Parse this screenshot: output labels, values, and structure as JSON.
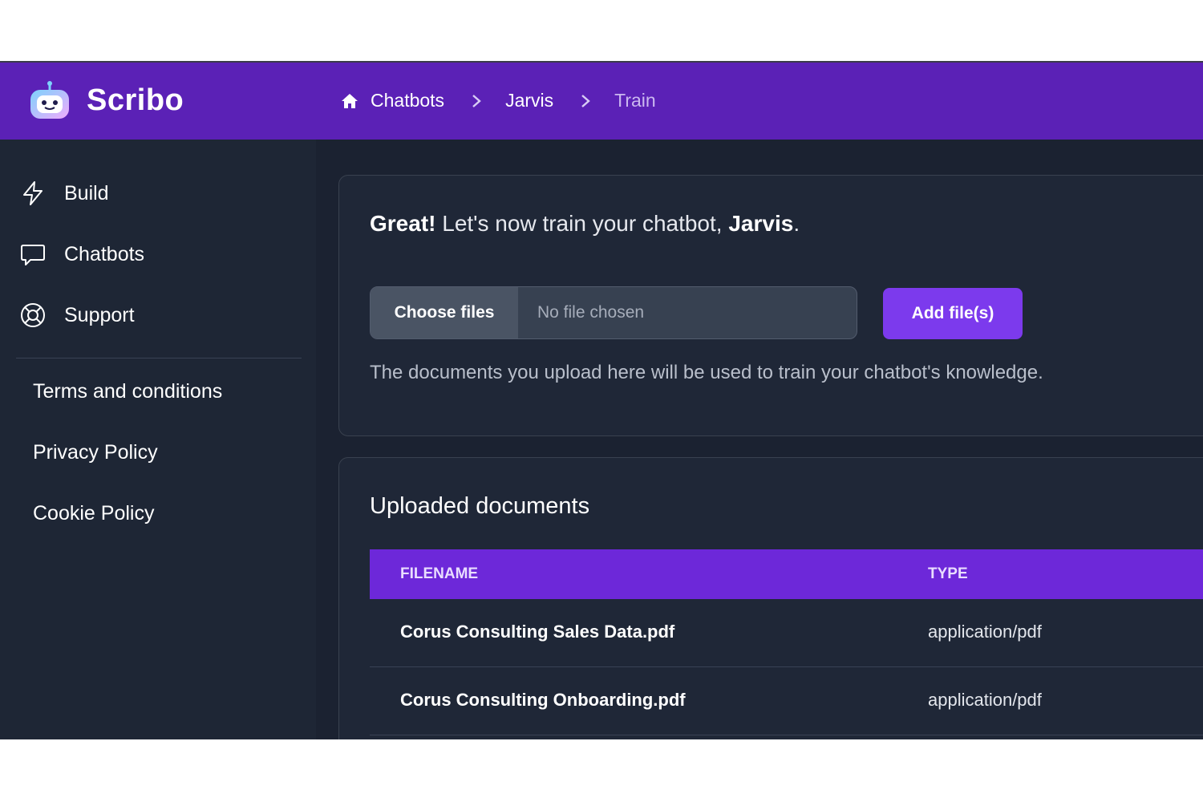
{
  "app": {
    "brand": "Scribo"
  },
  "breadcrumb": {
    "items": [
      "Chatbots",
      "Jarvis",
      "Train"
    ]
  },
  "sidebar": {
    "nav": [
      {
        "label": "Build",
        "icon": "lightning-icon"
      },
      {
        "label": "Chatbots",
        "icon": "chat-bubble-icon"
      },
      {
        "label": "Support",
        "icon": "lifebuoy-icon"
      }
    ],
    "links": [
      "Terms and conditions",
      "Privacy Policy",
      "Cookie Policy"
    ]
  },
  "train": {
    "headline_strong": "Great!",
    "headline_text": " Let's now train your chatbot, ",
    "bot_name": "Jarvis",
    "headline_end": ".",
    "choose_label": "Choose files",
    "no_file_text": "No file chosen",
    "add_label": "Add file(s)",
    "helper": "The documents you upload here will be used to train your chatbot's knowledge."
  },
  "documents": {
    "title": "Uploaded documents",
    "columns": [
      "FILENAME",
      "TYPE"
    ],
    "rows": [
      {
        "filename": "Corus Consulting Sales Data.pdf",
        "type": "application/pdf"
      },
      {
        "filename": "Corus Consulting Onboarding.pdf",
        "type": "application/pdf"
      }
    ]
  },
  "colors": {
    "header": "#5b21b6",
    "accent": "#7c3aed",
    "table_header": "#6d28d9",
    "background": "#1b2231"
  }
}
